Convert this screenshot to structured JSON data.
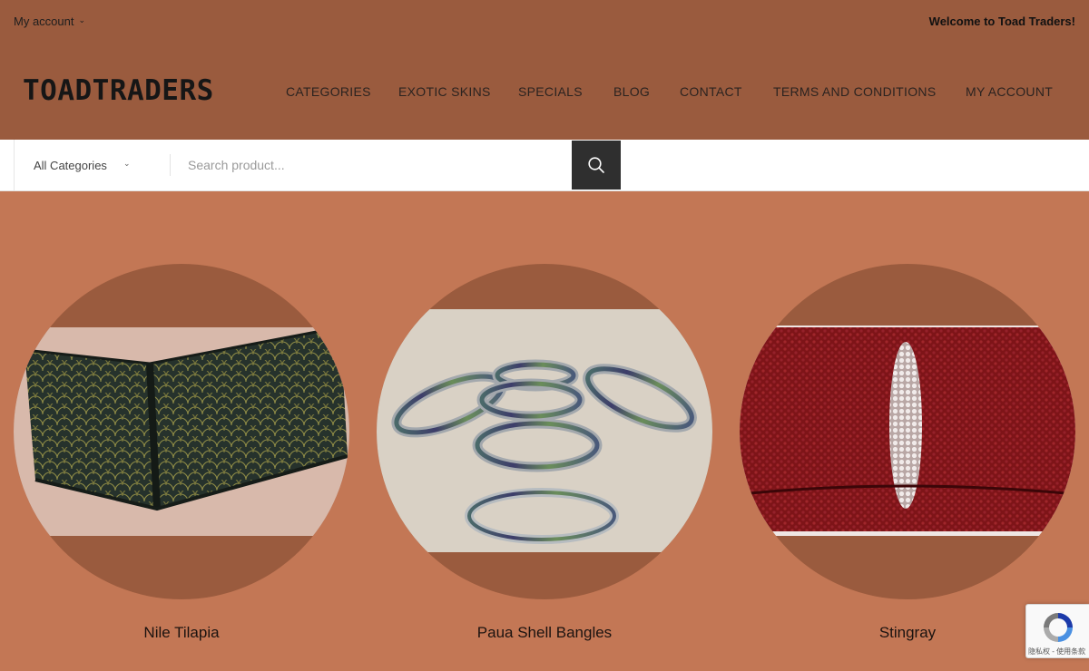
{
  "header": {
    "account_menu": "My account",
    "welcome": "Welcome to Toad Traders!",
    "logo": "TOADTRADERS"
  },
  "nav": {
    "items": [
      {
        "label": "CATEGORIES"
      },
      {
        "label": "EXOTIC SKINS"
      },
      {
        "label": "SPECIALS"
      },
      {
        "label": "BLOG"
      },
      {
        "label": "CONTACT"
      },
      {
        "label": "TERMS AND CONDITIONS"
      },
      {
        "label": "MY ACCOUNT"
      }
    ]
  },
  "search": {
    "category": "All Categories",
    "placeholder": "Search product...",
    "icon": "search-icon"
  },
  "products": [
    {
      "title": "Nile Tilapia",
      "image": "green-tilapia-leather-wallet"
    },
    {
      "title": "Paua Shell Bangles",
      "image": "paua-shell-bangles"
    },
    {
      "title": "Stingray",
      "image": "red-stingray-leather-wallet"
    }
  ],
  "recaptcha": {
    "footer": "隐私权 - 使用条款"
  },
  "colors": {
    "header_bg": "#9a5b3e",
    "page_bg": "#c37755",
    "search_button": "#2f2f2f"
  }
}
